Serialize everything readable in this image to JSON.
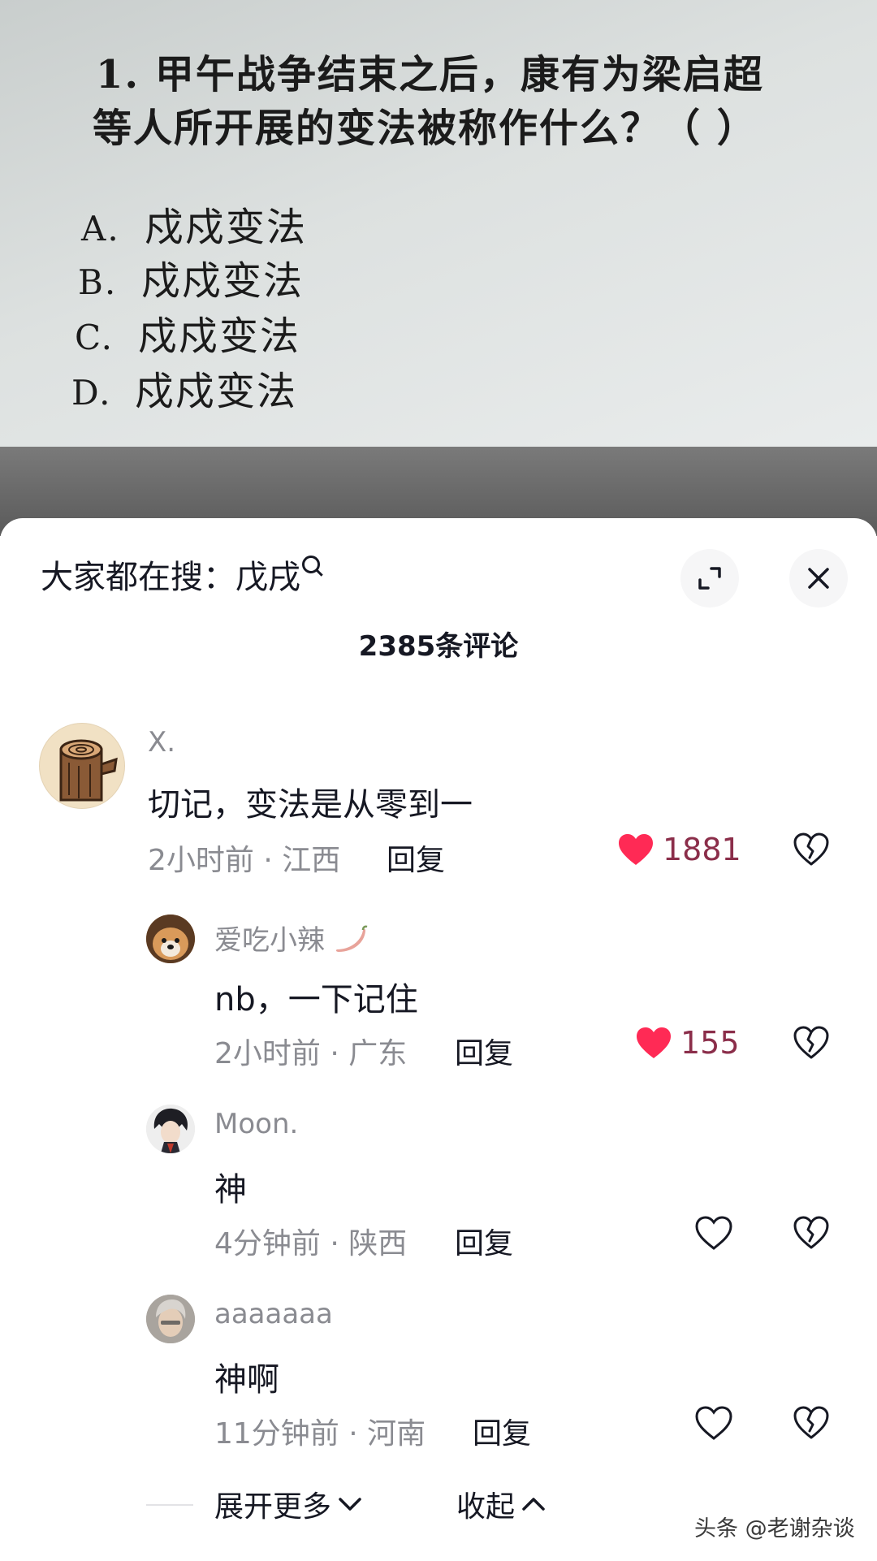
{
  "video": {
    "question_line1": "1.  甲午战争结束之后，康有为梁启超",
    "question_line2": "等人所开展的变法被称作什么？（    ）",
    "options": [
      {
        "key": "A.",
        "text": "戍戍变法"
      },
      {
        "key": "B.",
        "text": "戍戍变法"
      },
      {
        "key": "C.",
        "text": "戍戍变法"
      },
      {
        "key": "D.",
        "text": "戍戍变法"
      }
    ]
  },
  "header": {
    "search_prefix": "大家都在搜：",
    "search_term": "戊戌",
    "search_icon": "search-icon",
    "expand_icon": "expand-icon",
    "close_icon": "close-icon"
  },
  "comment_count": "2385条评论",
  "comments": [
    {
      "user": "X.",
      "text": "切记，变法是从零到一",
      "time_location": "2小时前 · 江西",
      "reply_label": "回复",
      "likes": "1881",
      "liked": true,
      "avatar": "tree-stump-avatar"
    },
    {
      "user": "爱吃小辣",
      "user_emoji": "chili-pepper-icon",
      "text": "nb，一下记住",
      "time_location": "2小时前 · 广东",
      "reply_label": "回复",
      "likes": "155",
      "liked": true,
      "avatar": "dog-avatar"
    },
    {
      "user": "Moon.",
      "text": "神",
      "time_location": "4分钟前 · 陕西",
      "reply_label": "回复",
      "likes": "",
      "liked": false,
      "avatar": "anime-character-avatar"
    },
    {
      "user": "aaaaaaa",
      "text": "神啊",
      "time_location": "11分钟前 · 河南",
      "reply_label": "回复",
      "likes": "",
      "liked": false,
      "avatar": "person-photo-avatar"
    }
  ],
  "footer": {
    "expand_more": "展开更多",
    "collapse": "收起",
    "watermark": "头条 @老谢杂谈"
  },
  "colors": {
    "like_active": "#ff2a55",
    "like_count": "#8b2e4a",
    "secondary_text": "#8a8b91",
    "primary_text": "#161823"
  }
}
